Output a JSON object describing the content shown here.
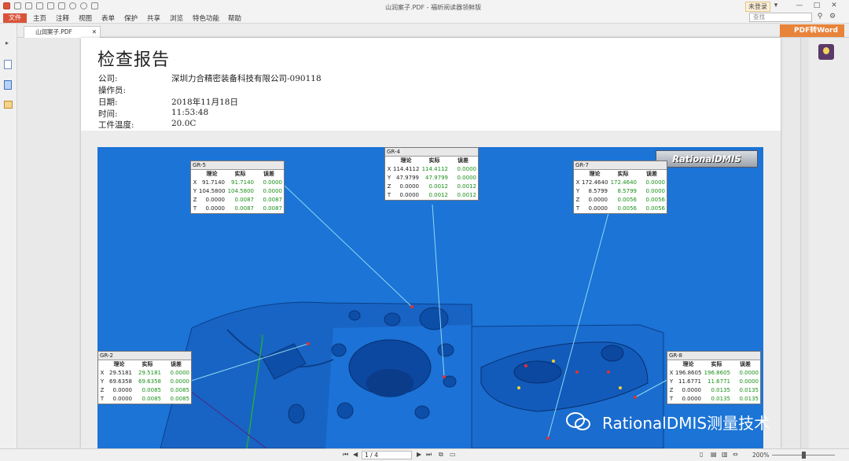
{
  "menu": {
    "file": "文件",
    "items": [
      "主页",
      "注释",
      "视图",
      "表单",
      "保护",
      "共享",
      "浏览",
      "特色功能",
      "帮助"
    ],
    "window_title": "山润案子.PDF - 福昕阅读器领鲜版",
    "login": "未登录",
    "search_placeholder": "查找"
  },
  "tab": {
    "label": "山润案子.PDF"
  },
  "pdf2word": "PDF转Word",
  "report": {
    "title": "检查报告",
    "fields": [
      {
        "label": "公司:",
        "value": "深圳力合精密装备科技有限公司-090118"
      },
      {
        "label": "操作员:",
        "value": ""
      },
      {
        "label": "日期:",
        "value": "2018年11月18日"
      },
      {
        "label": "时间:",
        "value": "11:53:48"
      },
      {
        "label": "工件温度:",
        "value": "20.0C"
      }
    ]
  },
  "scene": {
    "logo": "RationalDMIS",
    "headers": [
      "理论",
      "实际",
      "误差"
    ],
    "boxes": [
      {
        "title": "GR-5",
        "rows": [
          [
            "X",
            "91.7140",
            "91.7140",
            "0.0000"
          ],
          [
            "Y",
            "104.5800",
            "104.5800",
            "0.0000"
          ],
          [
            "Z",
            "0.0000",
            "0.0087",
            "0.0087"
          ],
          [
            "T",
            "0.0000",
            "0.0087",
            "0.0087"
          ]
        ]
      },
      {
        "title": "GR-4",
        "rows": [
          [
            "X",
            "114.4112",
            "114.4112",
            "0.0000"
          ],
          [
            "Y",
            "47.9799",
            "47.9799",
            "0.0000"
          ],
          [
            "Z",
            "0.0000",
            "0.0012",
            "0.0012"
          ],
          [
            "T",
            "0.0000",
            "0.0012",
            "0.0012"
          ]
        ]
      },
      {
        "title": "GR-7",
        "rows": [
          [
            "X",
            "172.4640",
            "172.4640",
            "0.0000"
          ],
          [
            "Y",
            "8.5799",
            "8.5799",
            "0.0000"
          ],
          [
            "Z",
            "0.0000",
            "0.0056",
            "0.0056"
          ],
          [
            "T",
            "0.0000",
            "0.0056",
            "0.0056"
          ]
        ]
      },
      {
        "title": "GR-2",
        "rows": [
          [
            "X",
            "29.5181",
            "29.5181",
            "0.0000"
          ],
          [
            "Y",
            "69.6358",
            "69.6358",
            "0.0000"
          ],
          [
            "Z",
            "0.0000",
            "0.0085",
            "0.0085"
          ],
          [
            "T",
            "0.0000",
            "0.0085",
            "0.0085"
          ]
        ]
      },
      {
        "title": "GR-8",
        "rows": [
          [
            "X",
            "196.8605",
            "196.8605",
            "0.0000"
          ],
          [
            "Y",
            "11.6771",
            "11.6771",
            "0.0000"
          ],
          [
            "Z",
            "0.0000",
            "0.0135",
            "0.0135"
          ],
          [
            "T",
            "0.0000",
            "0.0135",
            "0.0135"
          ]
        ]
      }
    ]
  },
  "watermark": "RationalDMIS测量技术",
  "status": {
    "page": "1 / 4",
    "zoom": "200%"
  }
}
